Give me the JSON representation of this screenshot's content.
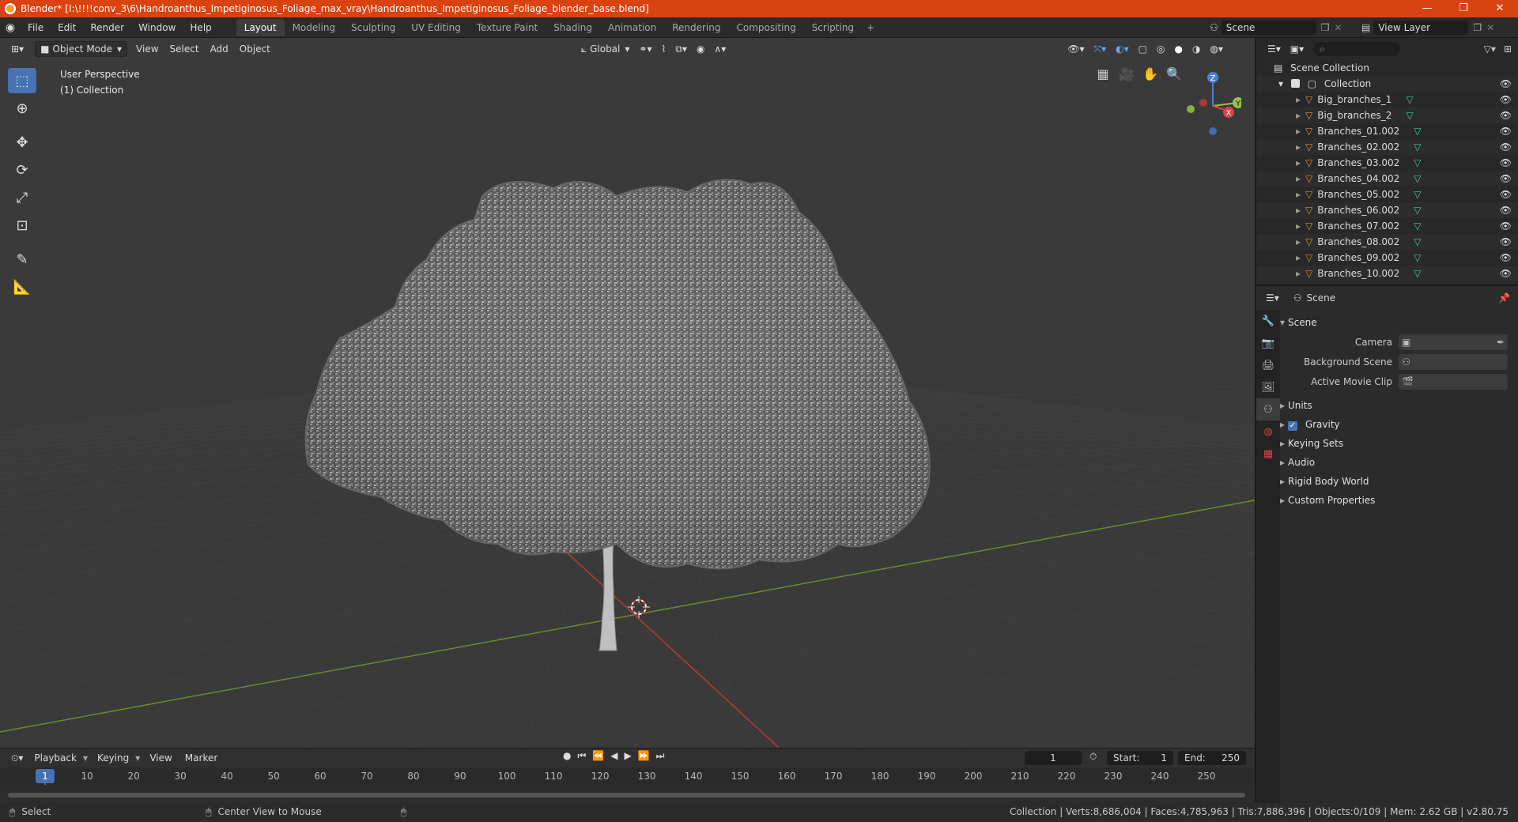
{
  "window": {
    "title": "Blender* [I:\\!!!!conv_3\\6\\Handroanthus_Impetiginosus_Foliage_max_vray\\Handroanthus_Impetiginosus_Foliage_blender_base.blend]",
    "controls": [
      "—",
      "❐",
      "✕"
    ]
  },
  "topbar": {
    "menu": [
      "File",
      "Edit",
      "Render",
      "Window",
      "Help"
    ],
    "workspaces": [
      "Layout",
      "Modeling",
      "Sculpting",
      "UV Editing",
      "Texture Paint",
      "Shading",
      "Animation",
      "Rendering",
      "Compositing",
      "Scripting"
    ],
    "active_workspace": "Layout",
    "add_workspace": "+",
    "scene": "Scene",
    "view_layer": "View Layer"
  },
  "viewport": {
    "mode": "Object Mode",
    "menus": [
      "View",
      "Select",
      "Add",
      "Object"
    ],
    "orientation": "Global",
    "info_line1": "User Perspective",
    "info_line2": "(1) Collection",
    "gizmo": {
      "z": "Z",
      "x": "X",
      "y": "Y"
    }
  },
  "outliner": {
    "root": "Scene Collection",
    "collection": "Collection",
    "objects": [
      "Big_branches_1",
      "Big_branches_2",
      "Branches_01.002",
      "Branches_02.002",
      "Branches_03.002",
      "Branches_04.002",
      "Branches_05.002",
      "Branches_06.002",
      "Branches_07.002",
      "Branches_08.002",
      "Branches_09.002",
      "Branches_10.002"
    ]
  },
  "properties": {
    "header": "Scene",
    "section": "Scene",
    "camera_label": "Camera",
    "background_label": "Background Scene",
    "movieclip_label": "Active Movie Clip",
    "panels": [
      "Units",
      "Gravity",
      "Keying Sets",
      "Audio",
      "Rigid Body World",
      "Custom Properties"
    ],
    "gravity_checked": true
  },
  "timeline": {
    "menus": [
      "Playback",
      "Keying",
      "View",
      "Marker"
    ],
    "current_frame": "1",
    "start_label": "Start:",
    "start": "1",
    "end_label": "End:",
    "end": "250",
    "ruler": [
      "1",
      "10",
      "20",
      "30",
      "40",
      "50",
      "60",
      "70",
      "80",
      "90",
      "100",
      "110",
      "120",
      "130",
      "140",
      "150",
      "160",
      "170",
      "180",
      "190",
      "200",
      "210",
      "220",
      "230",
      "240",
      "250"
    ]
  },
  "statusbar": {
    "select": "Select",
    "center_view": "Center View to Mouse",
    "stats": "Collection | Verts:8,686,004 | Faces:4,785,963 | Tris:7,886,396 | Objects:0/109 | Mem: 2.62 GB | v2.80.75"
  },
  "colors": {
    "titlebar": "#d94311",
    "accent": "#4772b3",
    "mesh_icon": "#e08a30",
    "data_icon": "#3fc9a0"
  }
}
